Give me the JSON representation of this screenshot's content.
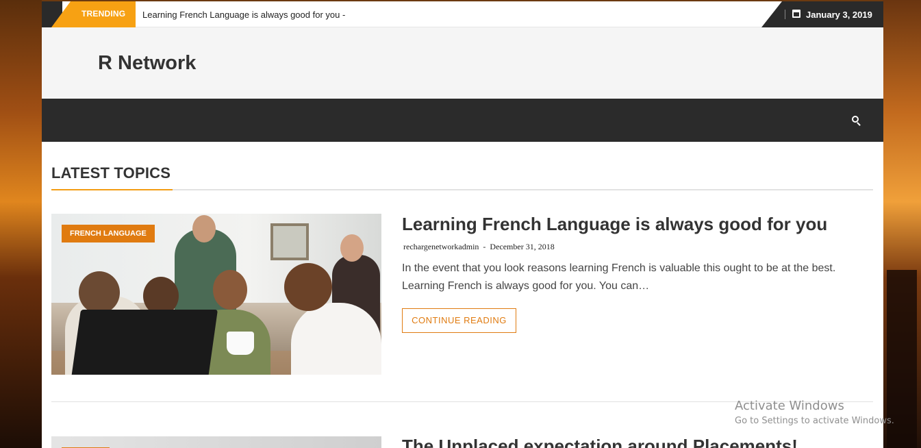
{
  "topbar": {
    "trending_label": "TRENDING",
    "ticker_text": "Learning French Language is always good for you -",
    "date": "January 3, 2019",
    "date_icon": "calendar-icon"
  },
  "header": {
    "site_title": "R Network"
  },
  "navbar": {
    "search_icon": "search-icon"
  },
  "main": {
    "section_title": "LATEST TOPICS",
    "posts": [
      {
        "category": "FRENCH LANGUAGE",
        "title": "Learning French Language is always good for you",
        "author": "rechargenetworkadmin",
        "meta_separator": "-",
        "date": "December 31, 2018",
        "excerpt": "In the event that you look reasons learning French is valuable this ought to be at the best. Learning French is always good for you. You can…",
        "read_more": "CONTINUE READING"
      },
      {
        "title": "The Unplaced expectation around Placements!"
      }
    ]
  },
  "watermark": {
    "line1": "Activate Windows",
    "line2": "Go to Settings to activate Windows."
  },
  "colors": {
    "accent": "#f39c12",
    "trending_badge": "#f7a113",
    "category_badge": "#e07b10",
    "navbar": "#2b2b2b",
    "header_bg": "#f5f5f5"
  }
}
